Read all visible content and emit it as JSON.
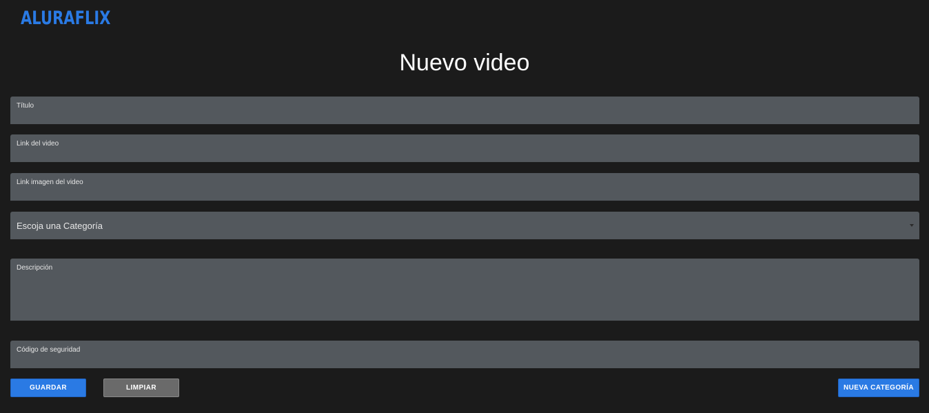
{
  "header": {
    "logo_text": "ALURAFLIX"
  },
  "page": {
    "title": "Nuevo video"
  },
  "form": {
    "titulo_label": "Título",
    "titulo_value": "",
    "link_video_label": "Link del video",
    "link_video_value": "",
    "link_imagen_label": "Link imagen del video",
    "link_imagen_value": "",
    "categoria_placeholder": "Escoja una Categoría",
    "descripcion_label": "Descripción",
    "descripcion_value": "",
    "codigo_label": "Código de seguridad",
    "codigo_value": ""
  },
  "buttons": {
    "guardar": "GUARDAR",
    "limpiar": "LIMPIAR",
    "nueva_categoria": "NUEVA CATEGORÍA"
  },
  "colors": {
    "background": "#1b1b1b",
    "field_background": "#53585d",
    "accent": "#2a7ae4",
    "secondary_button": "#6a6a6a"
  },
  "icons": {
    "select_arrow": "caret-down-icon"
  }
}
